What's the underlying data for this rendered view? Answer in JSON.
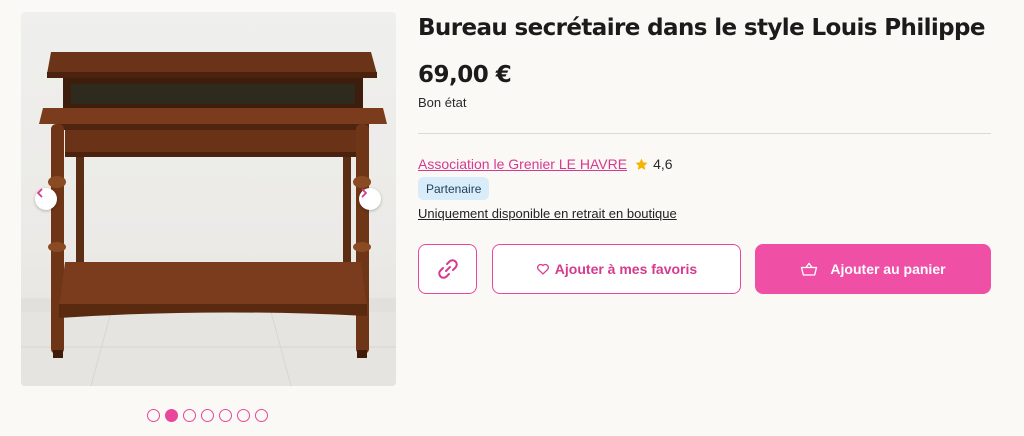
{
  "product": {
    "title": "Bureau secrétaire dans le style Louis Philippe",
    "price": "69,00 €",
    "condition": "Bon état"
  },
  "seller": {
    "name": "Association le Grenier LE HAVRE",
    "rating": "4,6",
    "badge": "Partenaire",
    "pickup_note": "Uniquement disponible en retrait en boutique"
  },
  "actions": {
    "favorite_label": "Ajouter à mes favoris",
    "cart_label": "Ajouter au panier"
  },
  "gallery": {
    "image_count": 7,
    "active_index": 1
  },
  "icons": {
    "link": "link-icon",
    "heart": "heart-icon",
    "basket": "basket-icon",
    "star": "star-icon",
    "prev": "chevron-left-icon",
    "next": "chevron-right-icon"
  },
  "colors": {
    "accent": "#e8479c",
    "accent_fill": "#f04fa6",
    "star": "#f4b400",
    "badge_bg": "#d9ecf9"
  }
}
